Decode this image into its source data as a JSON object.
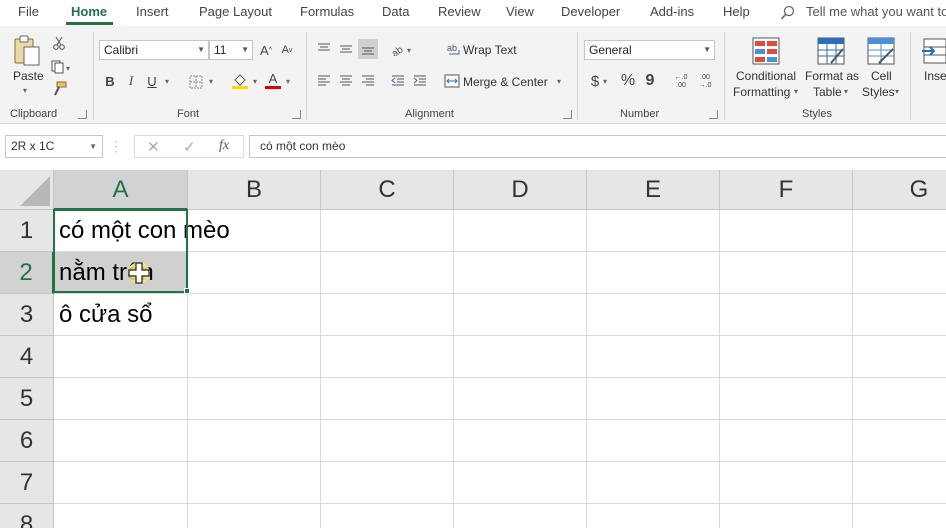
{
  "tabs": {
    "items": [
      "File",
      "Home",
      "Insert",
      "Page Layout",
      "Formulas",
      "Data",
      "Review",
      "View",
      "Developer",
      "Add-ins",
      "Help"
    ],
    "active": "Home",
    "tell_me": "Tell me what you want to"
  },
  "ribbon": {
    "clipboard": {
      "label": "Clipboard",
      "paste": "Paste"
    },
    "font": {
      "label": "Font",
      "name": "Calibri",
      "size": "11",
      "bold": "B",
      "italic": "I",
      "underline": "U",
      "font_color_glyph": "A"
    },
    "alignment": {
      "label": "Alignment",
      "wrap_text": "Wrap Text",
      "merge_center": "Merge & Center"
    },
    "number": {
      "label": "Number",
      "format": "General",
      "currency": "$",
      "percent": "%",
      "comma": "9",
      "inc_decimal": "←.0 .00",
      "dec_decimal": ".00 →.0"
    },
    "styles": {
      "label": "Styles",
      "conditional_1": "Conditional",
      "conditional_2": "Formatting",
      "format_as_1": "Format as",
      "format_as_2": "Table",
      "cell_styles_1": "Cell",
      "cell_styles_2": "Styles"
    },
    "cells": {
      "insert": "Inse"
    }
  },
  "formula_bar": {
    "name_box": "2R x 1C",
    "fx": "fx",
    "content": "có một con mèo"
  },
  "sheet": {
    "columns": [
      "A",
      "B",
      "C",
      "D",
      "E",
      "F",
      "G"
    ],
    "rows": [
      "1",
      "2",
      "3",
      "4",
      "5",
      "6",
      "7",
      "8"
    ],
    "cells": {
      "A1": "có một con mèo",
      "A2": "nằm trên",
      "A3": "ô cửa sổ"
    },
    "selection": "A1:A2"
  },
  "colors": {
    "accent": "#217346",
    "selected_fill": "#d0d0d0",
    "header_fill": "#e6e6e6"
  }
}
